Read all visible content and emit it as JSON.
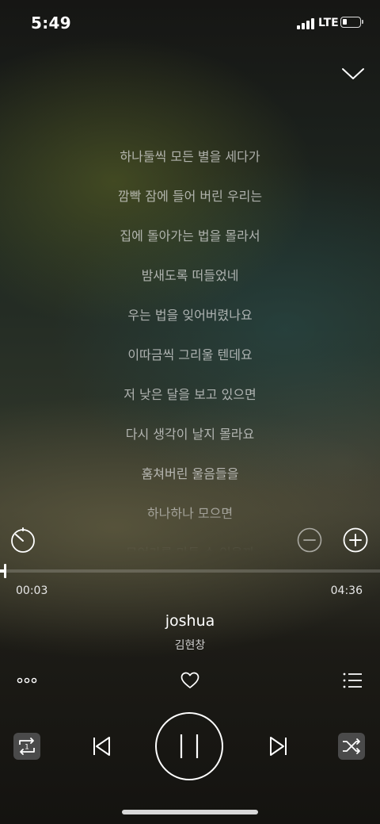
{
  "status_bar": {
    "time": "5:49",
    "network": "LTE",
    "icons": [
      "signal-icon",
      "battery-icon"
    ]
  },
  "header": {
    "collapse_icon": "chevron-down-icon"
  },
  "lyrics": [
    "하나둘씩 모든 별을 세다가",
    "깜빡 잠에 들어 버린 우리는",
    "집에 돌아가는 법을 몰라서",
    "밤새도록 떠들었네",
    "우는 법을 잊어버렸나요",
    "이따금씩 그리울 텐데요",
    "저 낮은 달을 보고 있으면",
    "다시 생각이 날지 몰라요",
    "훔쳐버린 울음들을",
    "하나하나 모으면",
    "무언가를 만들 수 있을까"
  ],
  "lyric_controls": {
    "timer_icon": "timer-icon",
    "decrease_icon": "minus-circle-icon",
    "increase_icon": "plus-circle-icon"
  },
  "playback": {
    "elapsed": "00:03",
    "duration": "04:36",
    "progress_fraction": 0.011
  },
  "track": {
    "title": "joshua",
    "artist": "김현창"
  },
  "actions": {
    "more_icon": "more-dots-icon",
    "like_icon": "heart-icon",
    "playlist_icon": "playlist-icon"
  },
  "controls": {
    "repeat_icon": "repeat-one-icon",
    "repeat_badge": "1",
    "prev_icon": "previous-icon",
    "pause_icon": "pause-icon",
    "next_icon": "next-icon",
    "shuffle_icon": "shuffle-icon"
  },
  "colors": {
    "accent": "#ffffff",
    "control_background": "#4a4a4a"
  }
}
